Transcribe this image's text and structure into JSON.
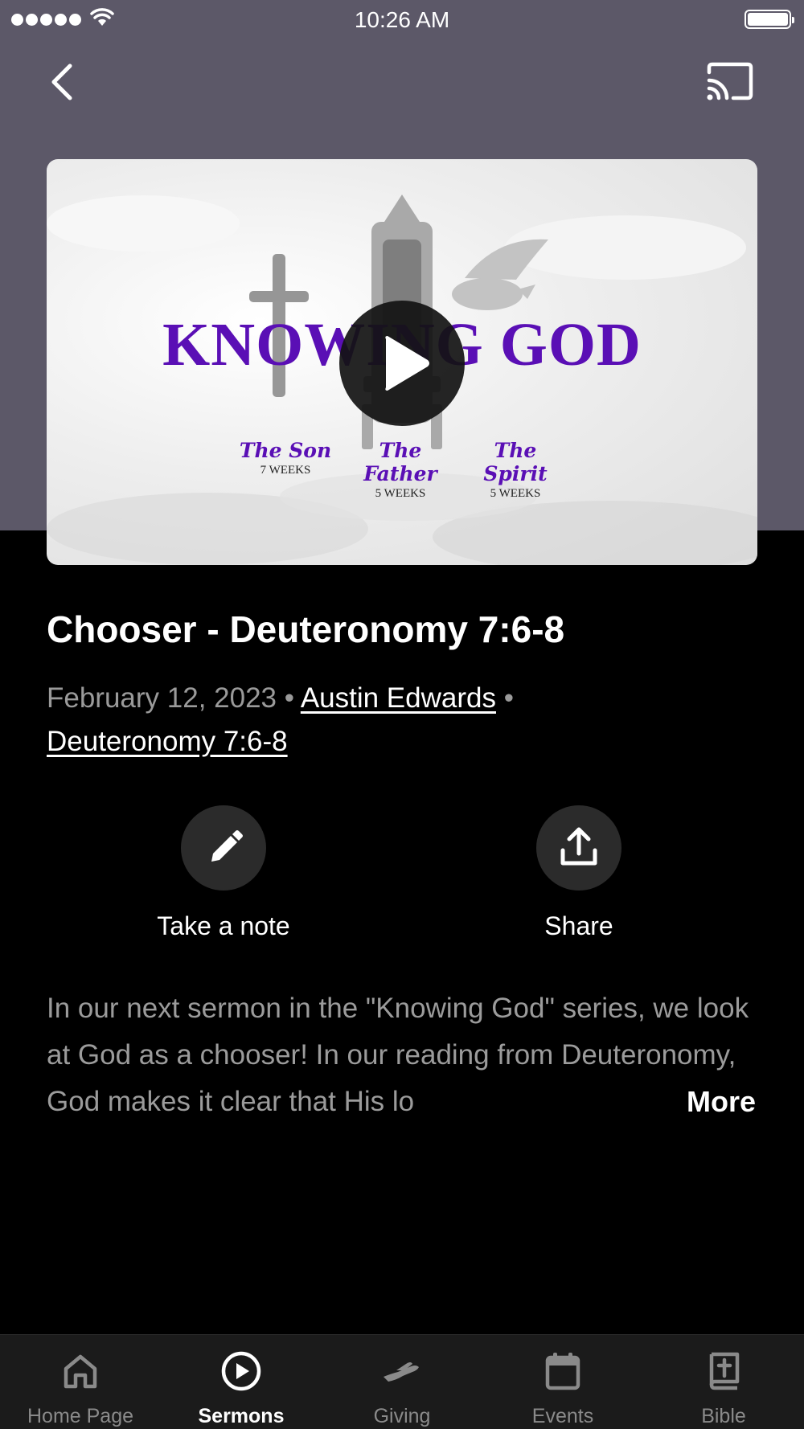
{
  "status_bar": {
    "time": "10:26 AM",
    "signal_bars": 5,
    "wifi": true,
    "battery_percent": 100
  },
  "header": {
    "back_icon": "chevron-left-icon",
    "cast_icon": "cast-icon",
    "background_color": "#5c5868"
  },
  "artwork": {
    "title": "KNOWING GOD",
    "weeks": [
      {
        "label": "The Son",
        "duration": "7 WEEKS"
      },
      {
        "label": "The Father",
        "duration": "5 WEEKS"
      },
      {
        "label": "The Spirit",
        "duration": "5 WEEKS"
      }
    ],
    "accent_color": "#5a0fb5",
    "play_icon": "play-icon"
  },
  "sermon": {
    "title": "Chooser - Deuteronomy 7:6-8",
    "date": "February 12, 2023",
    "separator": "•",
    "speaker": "Austin Edwards",
    "scripture": "Deuteronomy 7:6-8"
  },
  "actions": {
    "note": {
      "label": "Take a note",
      "icon": "pencil-icon"
    },
    "share": {
      "label": "Share",
      "icon": "share-icon"
    }
  },
  "description": {
    "text": "In our next sermon in the \"Knowing God\" series, we look at God as a chooser! In our reading from Deuteronomy, God makes it clear that His lo",
    "more_label": "More"
  },
  "tabs": [
    {
      "label": "Home Page",
      "icon": "home-icon",
      "active": false
    },
    {
      "label": "Sermons",
      "icon": "play-circle-icon",
      "active": true
    },
    {
      "label": "Giving",
      "icon": "giving-hand-icon",
      "active": false
    },
    {
      "label": "Events",
      "icon": "calendar-icon",
      "active": false
    },
    {
      "label": "Bible",
      "icon": "bible-icon",
      "active": false
    }
  ]
}
